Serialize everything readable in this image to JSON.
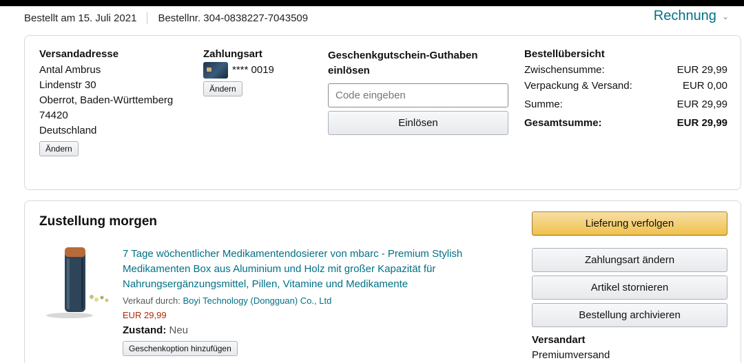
{
  "header": {
    "ordered_on": "Bestellt am 15. Juli 2021",
    "order_number": "Bestellnr. 304-0838227-7043509",
    "invoice_label": "Rechnung"
  },
  "address": {
    "heading": "Versandadresse",
    "lines": [
      "Antal Ambrus",
      "Lindenstr 30",
      "Oberrot, Baden-Württemberg",
      "74420",
      "Deutschland"
    ],
    "change_label": "Ändern"
  },
  "payment": {
    "heading": "Zahlungsart",
    "card_masked": "**** 0019",
    "change_label": "Ändern"
  },
  "gift": {
    "heading": "Geschenkgutschein-Guthaben einlösen",
    "placeholder": "Code eingeben",
    "redeem_label": "Einlösen"
  },
  "summary": {
    "heading": "Bestellübersicht",
    "rows": [
      {
        "label": "Zwischensumme:",
        "value": "EUR 29,99"
      },
      {
        "label": "Verpackung & Versand:",
        "value": "EUR 0,00"
      },
      {
        "label": "Summe:",
        "value": "EUR 29,99"
      }
    ],
    "total_label": "Gesamtsumme:",
    "total_value": "EUR 29,99"
  },
  "delivery": {
    "title": "Zustellung morgen",
    "product": {
      "title": "7 Tage wöchentlicher Medikamentendosierer von mbarc - Premium Stylish Medikamenten Box aus Aluminium und Holz mit großer Kapazität für Nahrungsergänzungsmittel, Pillen, Vitamine und Medikamente",
      "seller_prefix": "Verkauf durch:",
      "seller_name": "Boyi Technology (Dongguan) Co., Ltd",
      "price": "EUR 29,99",
      "condition_label": "Zustand:",
      "condition_value": "Neu",
      "gift_option_label": "Geschenkoption hinzufügen"
    },
    "actions": {
      "track": "Lieferung verfolgen",
      "change_payment": "Zahlungsart ändern",
      "cancel": "Artikel stornieren",
      "archive": "Bestellung archivieren"
    },
    "shipping_heading": "Versandart",
    "shipping_value": "Premiumversand"
  },
  "colors": {
    "link": "#007185",
    "price": "#b12704",
    "primary_button": "#f0c14b"
  }
}
